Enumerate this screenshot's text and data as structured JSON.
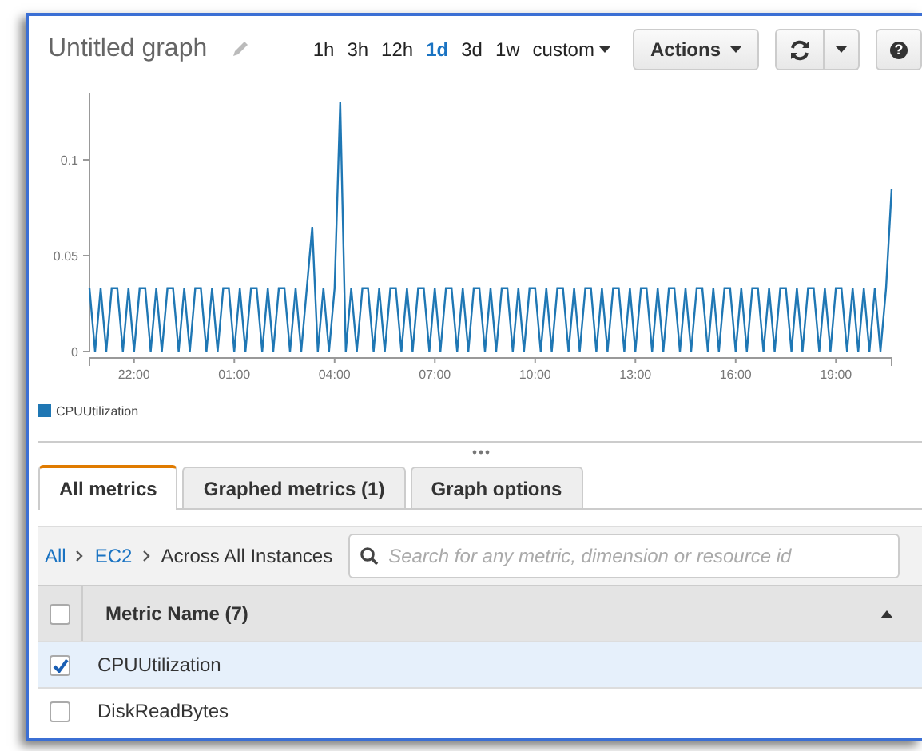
{
  "graph": {
    "title": "Untitled graph",
    "time_ranges": [
      {
        "label": "1h",
        "selected": false
      },
      {
        "label": "3h",
        "selected": false
      },
      {
        "label": "12h",
        "selected": false
      },
      {
        "label": "1d",
        "selected": true
      },
      {
        "label": "3d",
        "selected": false
      },
      {
        "label": "1w",
        "selected": false
      },
      {
        "label": "custom",
        "selected": false,
        "kind": "dropdown"
      }
    ],
    "actions_button": "Actions",
    "help_button": "?",
    "chart_data": {
      "type": "line",
      "ylim": [
        0,
        0.135
      ],
      "categories": [
        null,
        null,
        null,
        null,
        null,
        null,
        null,
        null,
        "22:00",
        null,
        null,
        null,
        null,
        null,
        null,
        null,
        null,
        null,
        null,
        null,
        null,
        null,
        null,
        null,
        null,
        null,
        "01:00",
        null,
        null,
        null,
        null,
        null,
        null,
        null,
        null,
        null,
        null,
        null,
        null,
        null,
        null,
        null,
        null,
        null,
        "04:00",
        null,
        null,
        null,
        null,
        null,
        null,
        null,
        null,
        null,
        null,
        null,
        null,
        null,
        null,
        null,
        null,
        null,
        "07:00",
        null,
        null,
        null,
        null,
        null,
        null,
        null,
        null,
        null,
        null,
        null,
        null,
        null,
        null,
        null,
        null,
        null,
        "10:00",
        null,
        null,
        null,
        null,
        null,
        null,
        null,
        null,
        null,
        null,
        null,
        null,
        null,
        null,
        null,
        null,
        null,
        "13:00",
        null,
        null,
        null,
        null,
        null,
        null,
        null,
        null,
        null,
        null,
        null,
        null,
        null,
        null,
        null,
        null,
        null,
        "16:00",
        null,
        null,
        null,
        null,
        null,
        null,
        null,
        null,
        null,
        null,
        null,
        null,
        null,
        null,
        null,
        null,
        null,
        "19:00",
        null,
        null,
        null,
        null,
        null,
        null,
        null,
        null,
        null,
        null
      ],
      "yticks": [
        {
          "value": 0,
          "label": "0"
        },
        {
          "value": 0.05,
          "label": "0.05"
        },
        {
          "value": 0.1,
          "label": "0.1"
        }
      ],
      "series": [
        {
          "name": "CPUUtilization",
          "color": "#1f77b4",
          "values": [
            0.033,
            0,
            0.033,
            0,
            0.033,
            0.033,
            0,
            0.033,
            0,
            0.033,
            0.033,
            0,
            0.033,
            0,
            0.033,
            0.033,
            0,
            0.033,
            0,
            0.033,
            0.033,
            0,
            0.033,
            0,
            0.033,
            0.033,
            0,
            0.033,
            0,
            0.033,
            0.033,
            0,
            0.033,
            0,
            0.033,
            0.033,
            0,
            0.033,
            0,
            0.033,
            0.065,
            0,
            0.033,
            0,
            0.033,
            0.13,
            0,
            0.033,
            0,
            0.033,
            0.033,
            0,
            0.033,
            0,
            0.033,
            0.033,
            0,
            0.033,
            0,
            0.033,
            0.033,
            0,
            0.033,
            0,
            0.033,
            0.033,
            0,
            0.033,
            0,
            0.033,
            0.033,
            0,
            0.033,
            0,
            0.033,
            0.033,
            0,
            0.033,
            0,
            0.033,
            0.033,
            0,
            0.033,
            0,
            0.033,
            0.033,
            0,
            0.033,
            0,
            0.033,
            0.033,
            0,
            0.033,
            0,
            0.033,
            0.033,
            0,
            0.033,
            0,
            0.033,
            0.033,
            0,
            0.033,
            0,
            0.033,
            0.033,
            0,
            0.033,
            0,
            0.033,
            0.033,
            0,
            0.033,
            0,
            0.033,
            0.033,
            0,
            0.033,
            0,
            0.033,
            0.033,
            0,
            0.033,
            0,
            0.033,
            0.033,
            0,
            0.033,
            0,
            0.033,
            0.033,
            0,
            0.033,
            0,
            0.033,
            0.033,
            0,
            0.033,
            0,
            0.033,
            0,
            0.033,
            0,
            0.033,
            0.085
          ]
        }
      ]
    }
  },
  "tabs": [
    {
      "label": "All metrics",
      "selected": true
    },
    {
      "label": "Graphed metrics (1)",
      "selected": false
    },
    {
      "label": "Graph options",
      "selected": false
    }
  ],
  "breadcrumb": [
    {
      "label": "All",
      "kind": "link"
    },
    {
      "label": "EC2",
      "kind": "link"
    },
    {
      "label": "Across All Instances",
      "kind": "current"
    }
  ],
  "search": {
    "placeholder": "Search for any metric, dimension or resource id"
  },
  "table": {
    "header_checked": false,
    "column": "Metric Name (7)",
    "rows": [
      {
        "name": "CPUUtilization",
        "checked": true,
        "selected": true
      },
      {
        "name": "DiskReadBytes",
        "checked": false,
        "selected": false
      }
    ]
  }
}
